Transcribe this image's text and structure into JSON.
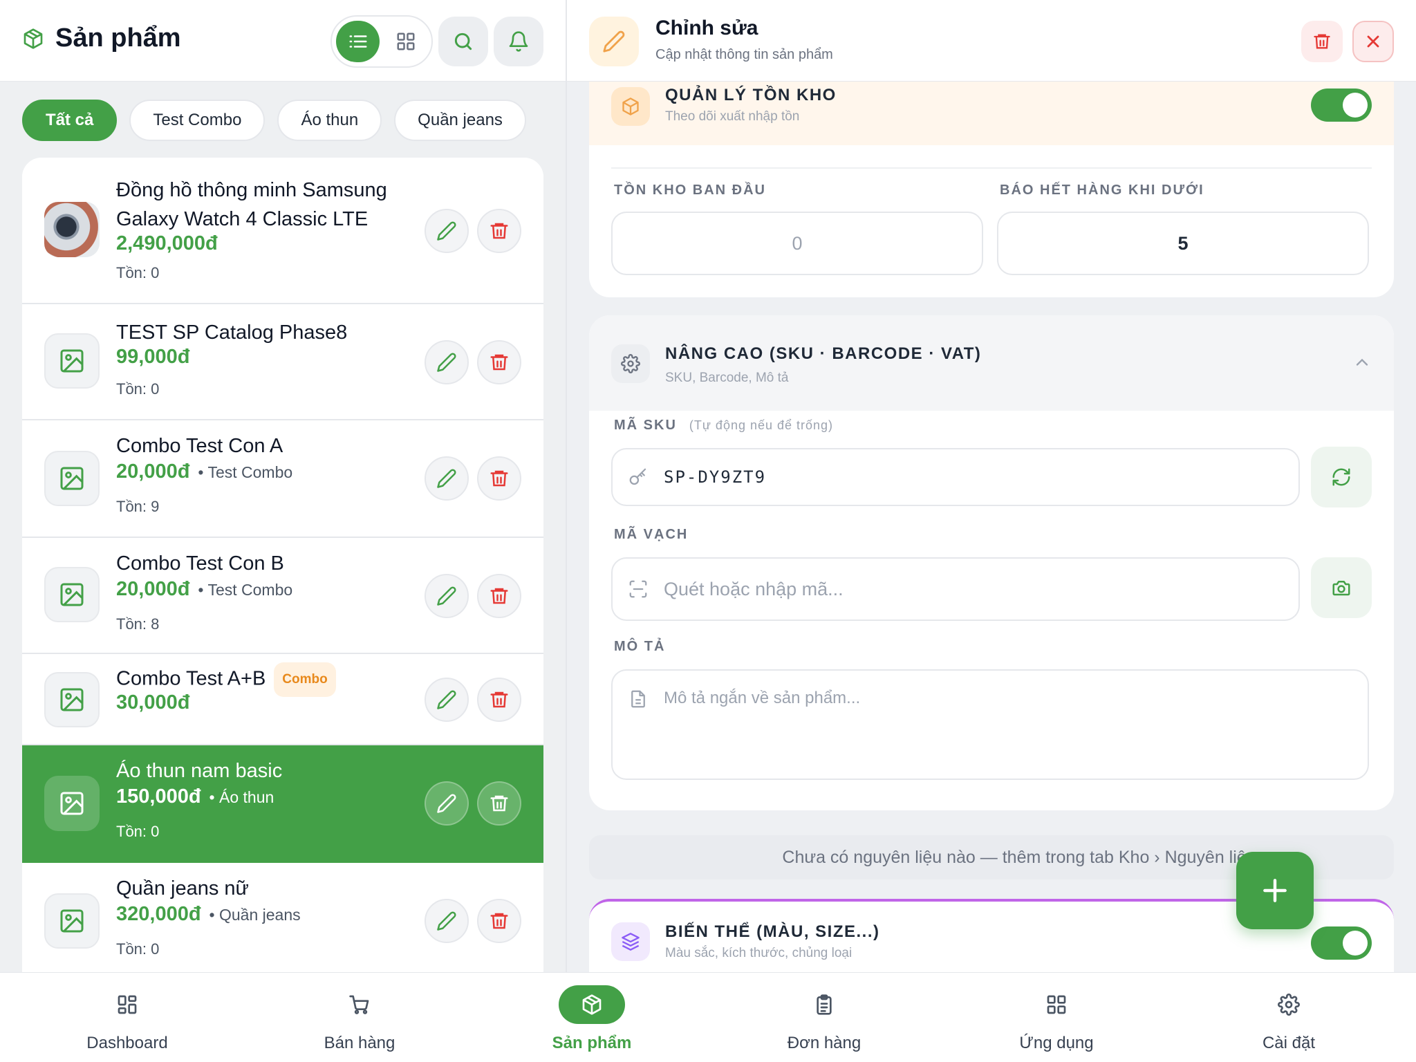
{
  "left": {
    "title": "Sản phẩm",
    "filters": [
      "Tất cả",
      "Test Combo",
      "Áo thun",
      "Quần jeans"
    ],
    "products": [
      {
        "name": "Đồng hồ thông minh Samsung Galaxy Watch 4 Classic LTE",
        "price": "2,490,000đ",
        "category": "",
        "stock": "Tồn: 0",
        "badge": ""
      },
      {
        "name": "TEST SP Catalog Phase8",
        "price": "99,000đ",
        "category": "",
        "stock": "Tồn: 0",
        "badge": ""
      },
      {
        "name": "Combo Test Con A",
        "price": "20,000đ",
        "category": "• Test Combo",
        "stock": "Tồn: 9",
        "badge": ""
      },
      {
        "name": "Combo Test Con B",
        "price": "20,000đ",
        "category": "• Test Combo",
        "stock": "Tồn: 8",
        "badge": ""
      },
      {
        "name": "Combo Test A+B",
        "price": "30,000đ",
        "category": "",
        "stock": "",
        "badge": "Combo"
      },
      {
        "name": "Áo thun nam basic",
        "price": "150,000đ",
        "category": "• Áo thun",
        "stock": "Tồn: 0",
        "badge": ""
      },
      {
        "name": "Quần jeans nữ",
        "price": "320,000đ",
        "category": "• Quần jeans",
        "stock": "Tồn: 0",
        "badge": ""
      }
    ]
  },
  "editor": {
    "title": "Chỉnh sửa",
    "subtitle": "Cập nhật thông tin sản phẩm",
    "inventory": {
      "title": "QUẢN LÝ TỒN KHO",
      "subtitle": "Theo dõi xuất nhập tồn",
      "enabled": true,
      "initial_label": "TỒN KHO BAN ĐẦU",
      "initial_value": "0",
      "threshold_label": "BÁO HẾT HÀNG KHI DƯỚI",
      "threshold_value": "5"
    },
    "advanced": {
      "title": "NÂNG CAO (SKU · BARCODE · VAT)",
      "subtitle": "SKU, Barcode, Mô tả",
      "sku_label": "MÃ SKU",
      "sku_hint": "(Tự động nếu để trống)",
      "sku_value": "SP-DY9ZT9",
      "barcode_label": "MÃ VẠCH",
      "barcode_placeholder": "Quét hoặc nhập mã...",
      "desc_label": "MÔ TẢ",
      "desc_placeholder": "Mô tả ngắn về sản phẩm..."
    },
    "ingredients_note": "Chưa có nguyên liệu nào — thêm trong tab Kho › Nguyên liệu",
    "variants": {
      "title": "BIẾN THỂ (MÀU, SIZE...)",
      "subtitle": "Màu sắc, kích thước, chủng loại",
      "enabled": true
    }
  },
  "nav": [
    {
      "label": "Dashboard",
      "icon": "dashboard-icon"
    },
    {
      "label": "Bán hàng",
      "icon": "cart-icon"
    },
    {
      "label": "Sản phẩm",
      "icon": "box-icon",
      "active": true
    },
    {
      "label": "Đơn hàng",
      "icon": "clipboard-icon"
    },
    {
      "label": "Ứng dụng",
      "icon": "apps-icon"
    },
    {
      "label": "Cài đặt",
      "icon": "gear-icon"
    }
  ],
  "colors": {
    "accent": "#43a047",
    "danger": "#e53935",
    "warning": "#f0a24a",
    "purple": "#8b5cf6"
  }
}
